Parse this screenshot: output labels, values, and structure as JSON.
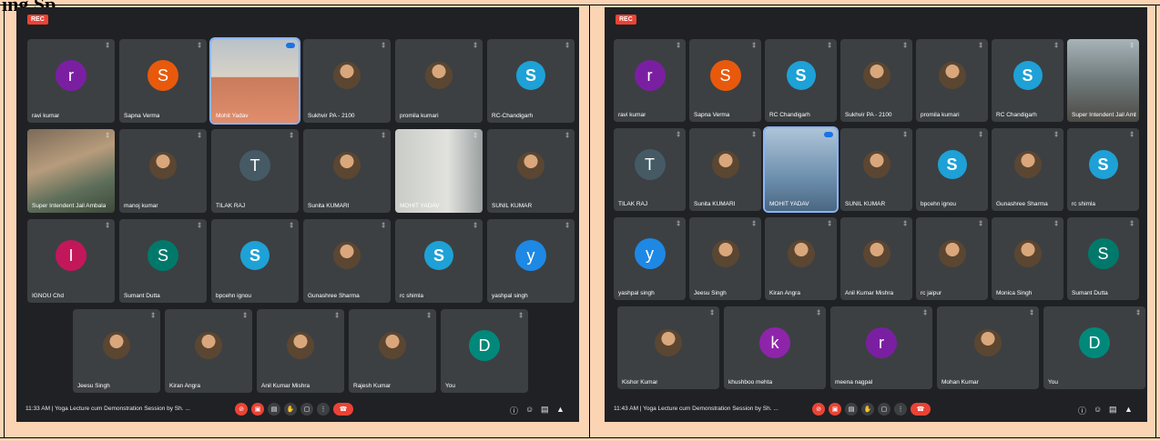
{
  "doc_title": "ing Sp",
  "meetings": [
    {
      "rec_label": "REC",
      "time": "11:33 AM",
      "title": "Yoga Lecture cum Demonstration Session by Sh. ...",
      "tiles": [
        {
          "name": "ravi kumar",
          "kind": "avatar",
          "letter": "r",
          "color": "#7b1fa2"
        },
        {
          "name": "Sapna Verma",
          "kind": "avatar",
          "letter": "S",
          "color": "#e8590c"
        },
        {
          "name": "Mohit Yadav",
          "kind": "video",
          "style": "v-face",
          "active": true
        },
        {
          "name": "Sukhvir PA - 2100",
          "kind": "photo"
        },
        {
          "name": "promila kumari",
          "kind": "photo"
        },
        {
          "name": "RC-Chandigarh",
          "kind": "logo"
        },
        {
          "name": "Super Intendent Jail Ambala",
          "kind": "video",
          "style": "v-room"
        },
        {
          "name": "manoj kumar",
          "kind": "photo"
        },
        {
          "name": "TILAK RAJ",
          "kind": "avatar",
          "letter": "T",
          "color": "#455a64"
        },
        {
          "name": "Sunita KUMARI",
          "kind": "photo"
        },
        {
          "name": "MOHIT YADAV",
          "kind": "video",
          "style": "v-wall"
        },
        {
          "name": "SUNIL KUMAR",
          "kind": "photo"
        },
        {
          "name": "IGNOU Chd",
          "kind": "avatar",
          "letter": "I",
          "color": "#c2185b"
        },
        {
          "name": "Sumant Dutta",
          "kind": "avatar",
          "letter": "S",
          "color": "#00796b"
        },
        {
          "name": "bpcehn ignou",
          "kind": "logo"
        },
        {
          "name": "Gunashree Sharma",
          "kind": "photo"
        },
        {
          "name": "rc shimla",
          "kind": "logo"
        },
        {
          "name": "yashpal singh",
          "kind": "avatar",
          "letter": "y",
          "color": "#1e88e5"
        },
        {
          "name": "Jeesu Singh",
          "kind": "photo"
        },
        {
          "name": "Kiran Angra",
          "kind": "photo"
        },
        {
          "name": "Anil Kumar Mishra",
          "kind": "photo"
        },
        {
          "name": "Rajesh Kumar",
          "kind": "photo"
        },
        {
          "name": "You",
          "kind": "avatar",
          "letter": "D",
          "color": "#00897b"
        }
      ]
    },
    {
      "rec_label": "REC",
      "time": "11:43 AM",
      "title": "Yoga Lecture cum Demonstration Session by Sh. ...",
      "tiles": [
        {
          "name": "ravi kumar",
          "kind": "avatar",
          "letter": "r",
          "color": "#7b1fa2"
        },
        {
          "name": "Sapna Verma",
          "kind": "avatar",
          "letter": "S",
          "color": "#e8590c"
        },
        {
          "name": "RC Chandigarh",
          "kind": "logo"
        },
        {
          "name": "Sukhvir PA - 2100",
          "kind": "photo"
        },
        {
          "name": "promila kumari",
          "kind": "photo"
        },
        {
          "name": "RC Chandigarh",
          "kind": "logo"
        },
        {
          "name": "Super Intendent Jail Ambala",
          "kind": "video",
          "style": "v-outdoor"
        },
        {
          "name": "TILAK RAJ",
          "kind": "avatar",
          "letter": "T",
          "color": "#455a64"
        },
        {
          "name": "Sunita KUMARI",
          "kind": "photo"
        },
        {
          "name": "MOHIT YADAV",
          "kind": "video",
          "style": "v-blue",
          "active": true
        },
        {
          "name": "SUNIL KUMAR",
          "kind": "photo"
        },
        {
          "name": "bpcehn ignou",
          "kind": "logo"
        },
        {
          "name": "Gunashree Sharma",
          "kind": "photo"
        },
        {
          "name": "rc shimla",
          "kind": "logo"
        },
        {
          "name": "yashpal singh",
          "kind": "avatar",
          "letter": "y",
          "color": "#1e88e5"
        },
        {
          "name": "Jeesu Singh",
          "kind": "photo"
        },
        {
          "name": "Kiran Angra",
          "kind": "photo"
        },
        {
          "name": "Anil Kumar Mishra",
          "kind": "photo"
        },
        {
          "name": "rc jaipur",
          "kind": "photo"
        },
        {
          "name": "Monica Singh",
          "kind": "photo"
        },
        {
          "name": "Sumant Dutta",
          "kind": "avatar",
          "letter": "S",
          "color": "#00796b"
        },
        {
          "name": "Kishor Kumar",
          "kind": "photo"
        },
        {
          "name": "khushboo mehta",
          "kind": "avatar",
          "letter": "k",
          "color": "#8e24aa"
        },
        {
          "name": "meena nagpal",
          "kind": "avatar",
          "letter": "r",
          "color": "#7b1fa2"
        },
        {
          "name": "Mohan Kumar",
          "kind": "photo"
        },
        {
          "name": "You",
          "kind": "avatar",
          "letter": "D",
          "color": "#00897b"
        }
      ]
    }
  ]
}
